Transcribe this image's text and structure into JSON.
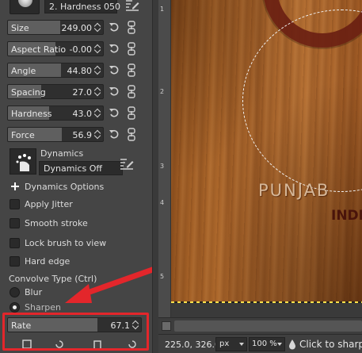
{
  "brush": {
    "name": "2. Hardness 050",
    "preview_icon": "brush-preview",
    "edit_icon": "edit-icon"
  },
  "sliders": [
    {
      "label": "Size",
      "value": "249.00",
      "fill": 0.55
    },
    {
      "label": "Aspect Ratio",
      "value": "-0.00",
      "fill": 0.5
    },
    {
      "label": "Angle",
      "value": "44.80",
      "fill": 0.56
    },
    {
      "label": "Spacing",
      "value": "27.0",
      "fill": 0.35
    },
    {
      "label": "Hardness",
      "value": "43.0",
      "fill": 0.43
    },
    {
      "label": "Force",
      "value": "56.9",
      "fill": 0.57
    }
  ],
  "dynamics": {
    "title": "Dynamics",
    "selected": "Dynamics Off"
  },
  "options": {
    "dynamics_options": "Dynamics Options",
    "apply_jitter": "Apply Jitter",
    "smooth_stroke": "Smooth stroke",
    "lock_brush": "Lock brush to view",
    "hard_edge": "Hard edge"
  },
  "convolve": {
    "label": "Convolve Type  (Ctrl)",
    "types": [
      {
        "label": "Blur",
        "selected": false
      },
      {
        "label": "Sharpen",
        "selected": true
      }
    ]
  },
  "rate": {
    "label": "Rate",
    "value": "67.1",
    "fill": 0.671
  },
  "ruler_vertical": [
    "1",
    "2",
    "3",
    "4",
    "5"
  ],
  "canvas_text": {
    "line1": "PUNJAB",
    "line2": "INDI"
  },
  "status": {
    "coords": "225.0, 326.0",
    "unit": "px",
    "zoom": "100 %",
    "hint": "Click to sharpen"
  },
  "colors": {
    "annotation": "#e3262b",
    "panel_bg": "#454545",
    "selection_dash": "#ffe24a"
  }
}
